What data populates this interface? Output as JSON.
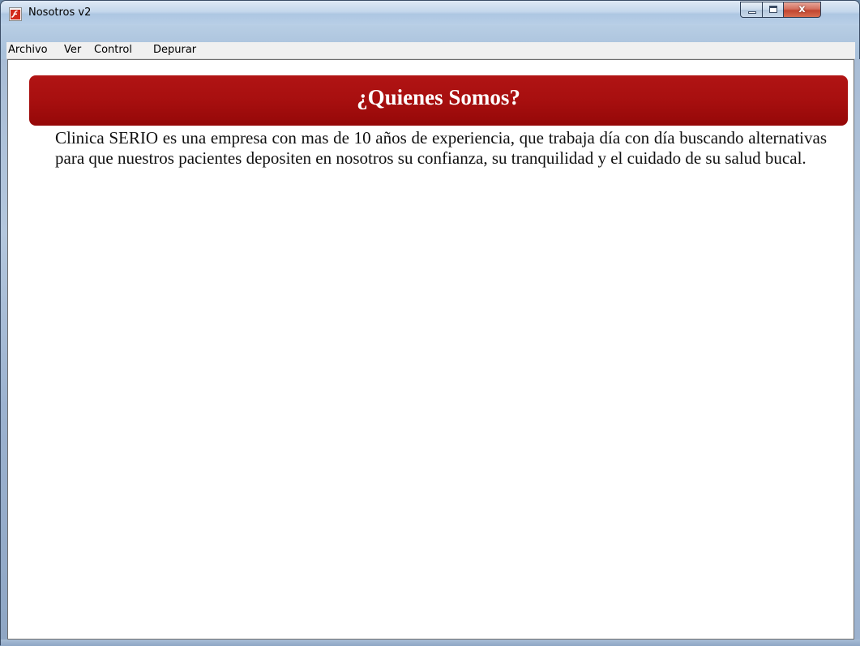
{
  "window": {
    "title": "Nosotros v2",
    "controls": {
      "minimize_icon": "minimize-icon",
      "maximize_icon": "maximize-icon",
      "close_glyph": "x"
    }
  },
  "menubar": {
    "items": [
      {
        "label": "Archivo"
      },
      {
        "label": "Ver"
      },
      {
        "label": "Control"
      },
      {
        "label": "Depurar"
      }
    ]
  },
  "content": {
    "heading": "¿Quienes Somos?",
    "paragraph": "Clinica SERIO es una empresa con mas de 10 años de experiencia, que trabaja día con día buscando alternativas para que nuestros pacientes depositen en nosotros su confianza, su tranquilidad y el cuidado de su salud bucal.",
    "banner_color": "#a70f0f"
  }
}
